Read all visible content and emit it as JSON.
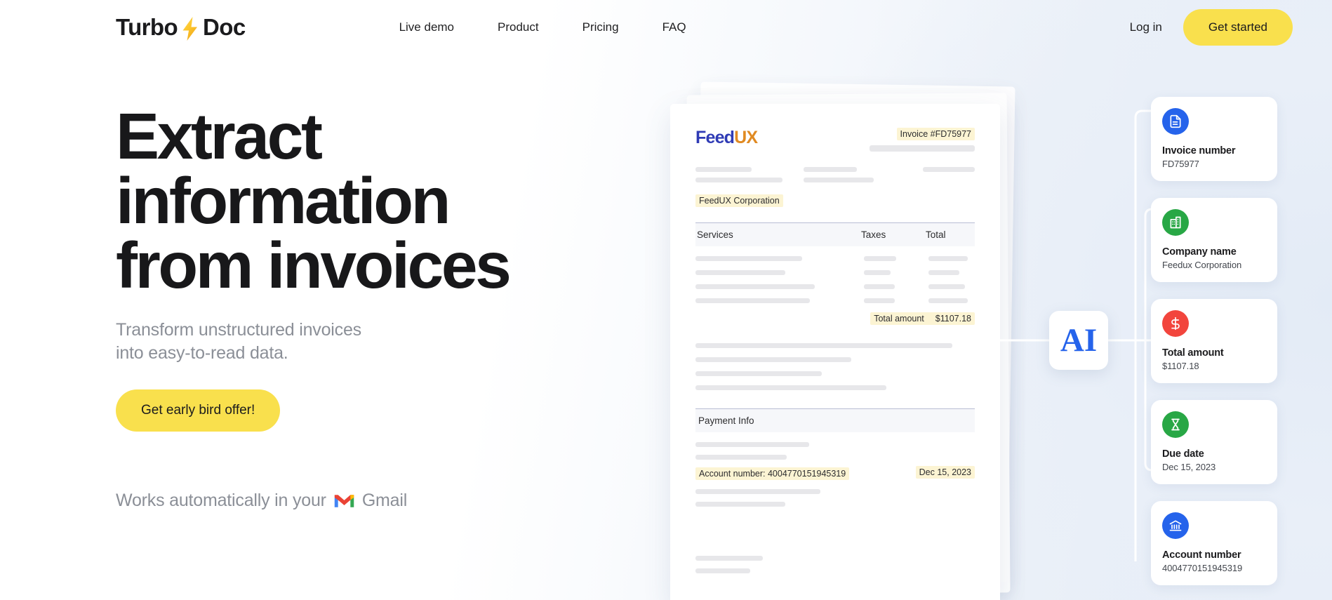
{
  "brand": {
    "name_before": "Turbo",
    "name_after": "Doc",
    "bolt_icon": "lightning-bolt-icon"
  },
  "nav": {
    "items": [
      {
        "label": "Live demo"
      },
      {
        "label": "Product"
      },
      {
        "label": "Pricing"
      },
      {
        "label": "FAQ"
      }
    ],
    "login_label": "Log in",
    "get_started_label": "Get started"
  },
  "hero": {
    "headline_line1": "Extract",
    "headline_line2": "information",
    "headline_line3": "from invoices",
    "subhead_line1": "Transform unstructured invoices",
    "subhead_line2": "into easy-to-read data.",
    "cta_label": "Get early bird offer!",
    "works_prefix": "Works automatically in your",
    "works_suffix": "Gmail",
    "gmail_icon": "gmail-icon"
  },
  "invoice": {
    "logo_part1": "Feed",
    "logo_part2": "UX",
    "invoice_number": "Invoice #FD75977",
    "company": "FeedUX Corporation",
    "table_headers": {
      "services": "Services",
      "taxes": "Taxes",
      "total": "Total"
    },
    "total_label": "Total amount",
    "total_value": "$1107.18",
    "payment_info_header": "Payment Info",
    "account_line": "Account number: 4004770151945319",
    "date": "Dec 15, 2023"
  },
  "ai_badge": {
    "label": "AI",
    "color": "#2563eb"
  },
  "extracted_cards": [
    {
      "icon": "document-icon",
      "icon_color": "#2563eb",
      "label": "Invoice number",
      "value": "FD75977"
    },
    {
      "icon": "building-icon",
      "icon_color": "#28a745",
      "label": "Company name",
      "value": "Feedux Corporation"
    },
    {
      "icon": "dollar-icon",
      "icon_color": "#f2453d",
      "label": "Total amount",
      "value": "$1107.18"
    },
    {
      "icon": "hourglass-icon",
      "icon_color": "#28a745",
      "label": "Due date",
      "value": "Dec 15, 2023"
    },
    {
      "icon": "bank-icon",
      "icon_color": "#2563eb",
      "label": "Account number",
      "value": "4004770151945319"
    }
  ],
  "colors": {
    "accent_yellow": "#f9e04d",
    "highlight_yellow": "#fcf4d3",
    "text_dark": "#18181a",
    "text_muted": "#8b8f97"
  }
}
